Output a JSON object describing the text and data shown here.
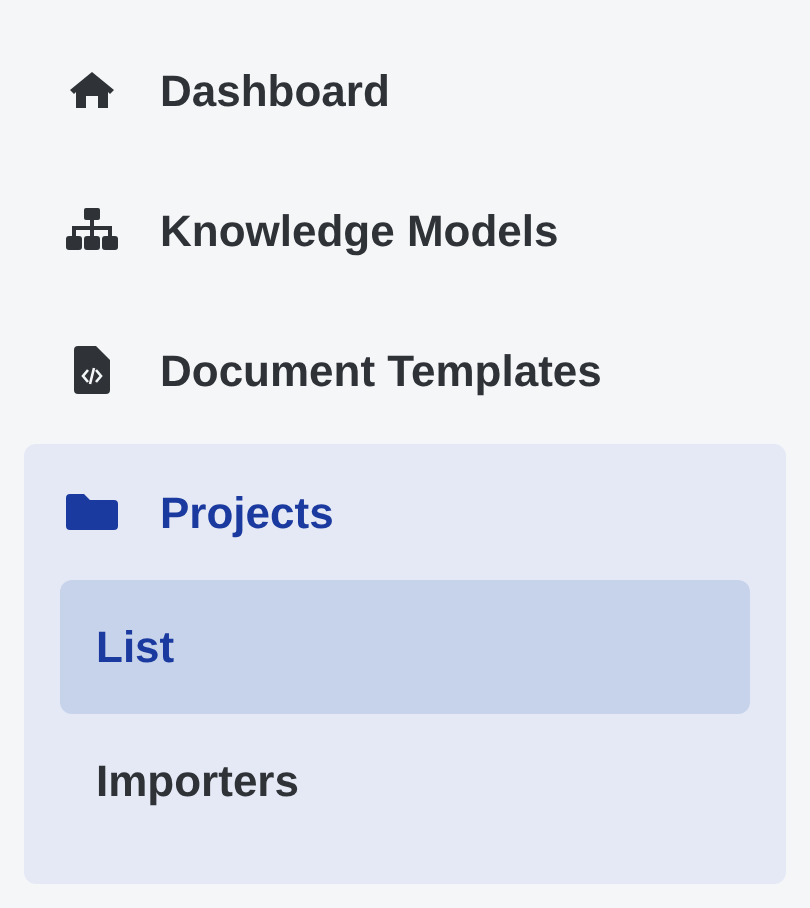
{
  "sidebar": {
    "items": [
      {
        "label": "Dashboard",
        "selected": false
      },
      {
        "label": "Knowledge Models",
        "selected": false
      },
      {
        "label": "Document Templates",
        "selected": false
      },
      {
        "label": "Projects",
        "selected": true,
        "expanded": true,
        "children": [
          {
            "label": "List",
            "selected": true
          },
          {
            "label": "Importers",
            "selected": false
          }
        ]
      }
    ]
  }
}
